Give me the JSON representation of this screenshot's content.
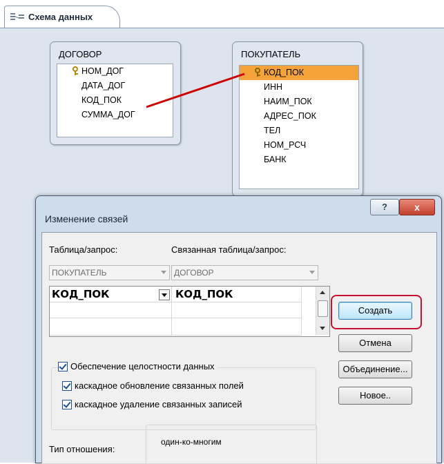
{
  "tab": {
    "label": "Схема данных",
    "icon": "relationships-icon"
  },
  "tables": [
    {
      "title": "ДОГОВОР",
      "fields": [
        {
          "name": "НОМ_ДОГ",
          "key": true
        },
        {
          "name": "ДАТА_ДОГ",
          "key": false
        },
        {
          "name": "КОД_ПОК",
          "key": false
        },
        {
          "name": "СУММА_ДОГ",
          "key": false
        }
      ]
    },
    {
      "title": "ПОКУПАТЕЛЬ",
      "fields": [
        {
          "name": "КОД_ПОК",
          "key": true,
          "selected": true
        },
        {
          "name": "ИНН",
          "key": false
        },
        {
          "name": "НАИМ_ПОК",
          "key": false
        },
        {
          "name": "АДРЕС_ПОК",
          "key": false
        },
        {
          "name": "ТЕЛ",
          "key": false
        },
        {
          "name": "НОМ_РСЧ",
          "key": false
        },
        {
          "name": "БАНК",
          "key": false
        }
      ]
    }
  ],
  "dialog": {
    "title": "Изменение связей",
    "help_label": "?",
    "close_label": "x",
    "table_label": "Таблица/запрос:",
    "related_label": "Связанная таблица/запрос:",
    "table_value": "ПОКУПАТЕЛЬ",
    "related_value": "ДОГОВОР",
    "rows": [
      {
        "left": "КОД_ПОК",
        "right": "КОД_ПОК"
      },
      {
        "left": "",
        "right": ""
      },
      {
        "left": "",
        "right": ""
      }
    ],
    "buttons": {
      "create": "Создать",
      "cancel": "Отмена",
      "join": "Объединение...",
      "new": "Новое.."
    },
    "checkboxes": [
      {
        "label": "Обеспечение целостности данных",
        "checked": true
      },
      {
        "label": "каскадное обновление связанных полей",
        "checked": true
      },
      {
        "label": "каскадное удаление связанных записей",
        "checked": true
      }
    ],
    "relation_type_label": "Тип отношения:",
    "relation_type_value": "один-ко-многим"
  },
  "colors": {
    "highlight": "#f3a33a",
    "relation_line": "#cc0000",
    "annotation": "#c8102e"
  }
}
